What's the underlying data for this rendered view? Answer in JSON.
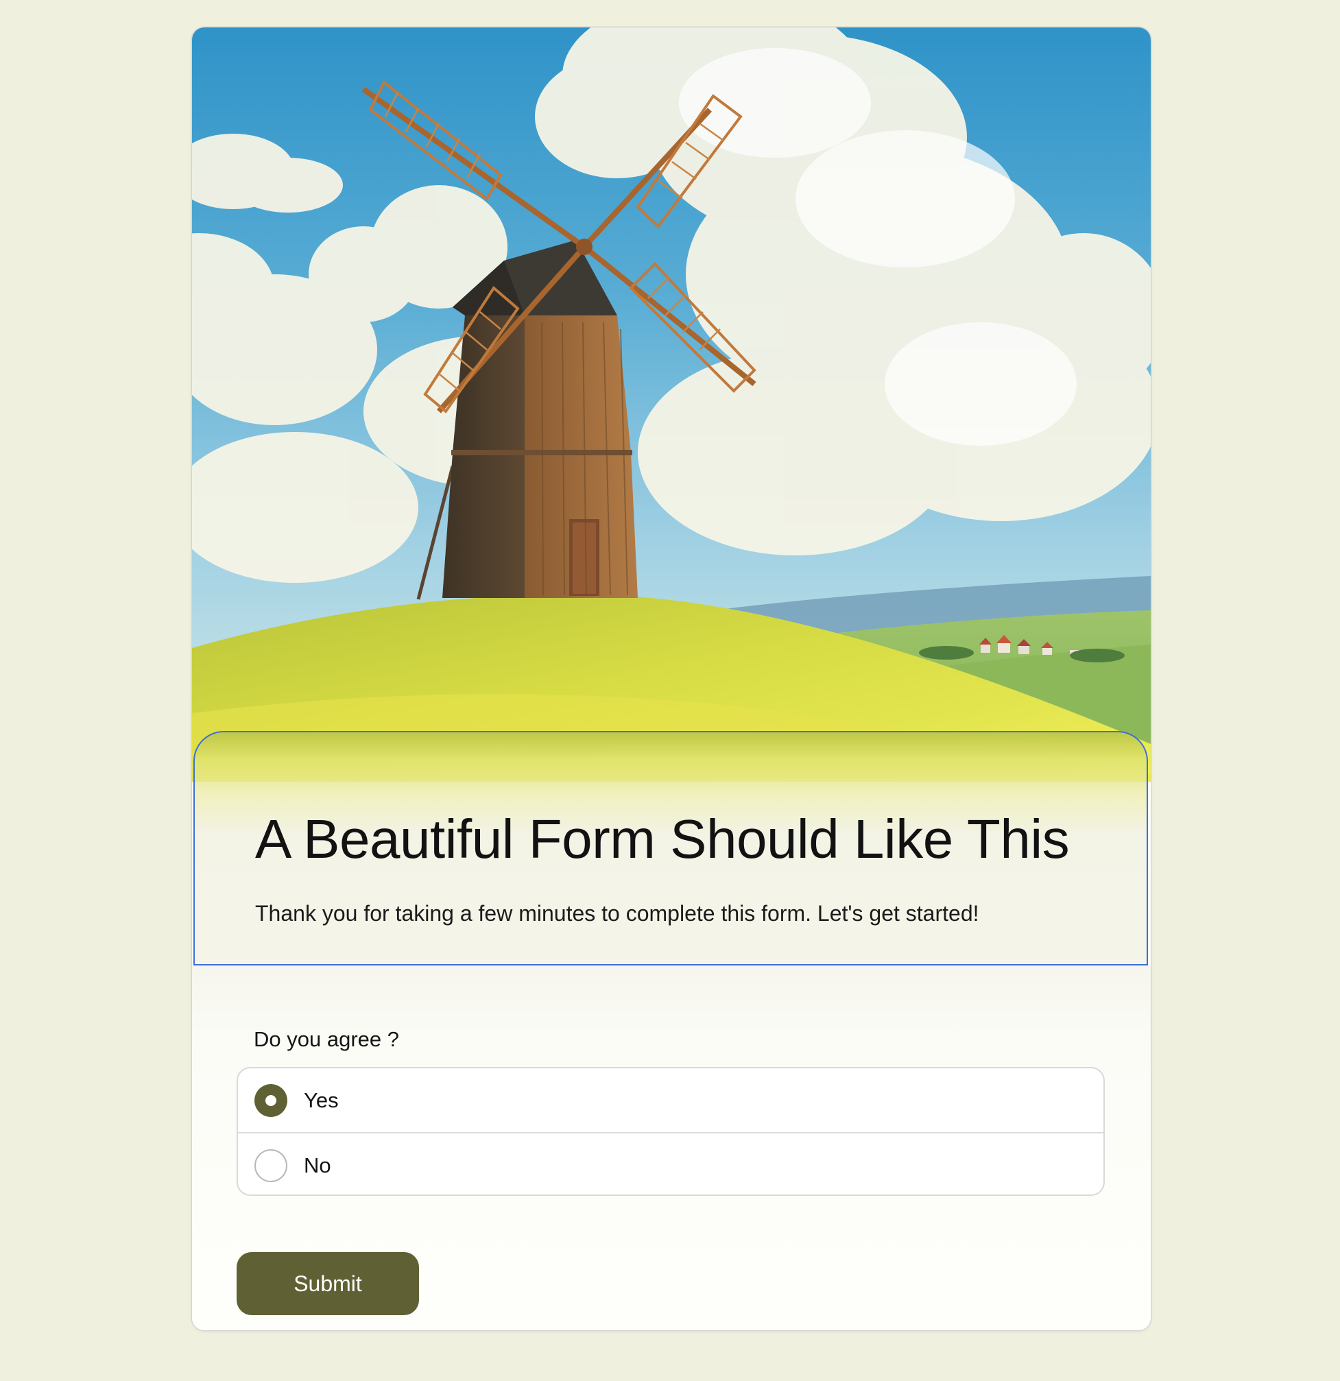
{
  "form": {
    "title": "A Beautiful Form Should Like This",
    "subtitle": "Thank you for taking a few minutes to complete this form. Let's get started!",
    "question": "Do you agree ?",
    "options": [
      {
        "label": "Yes",
        "selected": true
      },
      {
        "label": "No",
        "selected": false
      }
    ],
    "submit_label": "Submit"
  },
  "colors": {
    "page_background": "#eff0de",
    "accent": "#5f6134",
    "header_border": "#3f6ed8"
  }
}
